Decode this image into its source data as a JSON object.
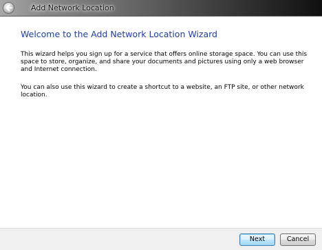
{
  "window": {
    "title": "Add Network Location"
  },
  "wizard": {
    "heading": "Welcome to the Add Network Location Wizard",
    "paragraph1": "This wizard helps you sign up for a service that offers online storage space.  You can use this space to store, organize, and share your documents and pictures using only a web browser and Internet connection.",
    "paragraph2": "You can also use this wizard to create a shortcut to a website, an FTP site, or other network location."
  },
  "buttons": {
    "next_label": "Next",
    "cancel_label": "Cancel"
  },
  "icons": {
    "back": "back-arrow-icon"
  },
  "colors": {
    "heading": "#1f3f9a",
    "default_button_border": "#3c7fb1",
    "footer_background": "#f0f0f0"
  }
}
